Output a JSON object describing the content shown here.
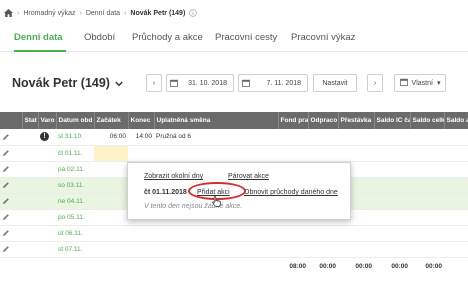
{
  "breadcrumb": {
    "items": [
      "Hromadný výkaz",
      "Denní data"
    ],
    "current": "Novák Petr (149)"
  },
  "tabs": [
    {
      "label": "Denní data",
      "active": true
    },
    {
      "label": "Období",
      "active": false
    },
    {
      "label": "Průchody a akce",
      "active": false
    },
    {
      "label": "Pracovní cesty",
      "active": false
    },
    {
      "label": "Pracovní výkaz",
      "active": false
    }
  ],
  "person": {
    "name": "Novák Petr (149)"
  },
  "filter": {
    "date_from": "31. 10. 2018",
    "date_to": "7. 11. 2018",
    "set_button": "Nastavit",
    "view_select": "Vlastní"
  },
  "table": {
    "headers": [
      "",
      "Stat",
      "Varo",
      "Datum obd",
      "Začátek",
      "Konec",
      "Uplatněná směna",
      "Fond prac",
      "Odpraco",
      "Přestávka",
      "Saldo IC čas",
      "Saldo celkem",
      "Saldo aktu"
    ],
    "rows": [
      {
        "warning": true,
        "date": "st 31.10.",
        "start": "06:00",
        "end": "14:00",
        "shift": "Pružná od 6",
        "green": false
      },
      {
        "warning": false,
        "date": "čt 01.11.",
        "start": "",
        "end": "",
        "shift": "",
        "green": false
      },
      {
        "warning": false,
        "date": "pá 02.11.",
        "start": "",
        "end": "",
        "shift": "",
        "green": false
      },
      {
        "warning": false,
        "date": "so 03.11.",
        "start": "",
        "end": "",
        "shift": "",
        "green": true
      },
      {
        "warning": false,
        "date": "ne 04.11.",
        "start": "",
        "end": "",
        "shift": "",
        "green": true
      },
      {
        "warning": false,
        "date": "po 05.11.",
        "start": "",
        "end": "",
        "shift": "",
        "green": false
      },
      {
        "warning": false,
        "date": "út 06.11.",
        "start": "",
        "end": "",
        "shift": "",
        "green": false
      },
      {
        "warning": false,
        "date": "st 07.11.",
        "start": "",
        "end": "",
        "shift": "",
        "green": false
      }
    ],
    "totals": [
      "08:00",
      "00:00",
      "00:00",
      "00:00",
      "00:00"
    ]
  },
  "popup": {
    "show_surrounding_days": "Zobrazit okolní dny",
    "pair_actions": "Párovat akce",
    "date": "čt 01.11.2018",
    "add_action": "Přidat akci",
    "refresh_passes": "Obnovit průchody daného dne",
    "note": "V tento den nejsou žádné akce."
  },
  "colors": {
    "accent": "#4caf50",
    "header_bg": "#6b6b6b",
    "weekend_bg": "#e9f5e1",
    "highlight_ring": "#d32f2f"
  }
}
